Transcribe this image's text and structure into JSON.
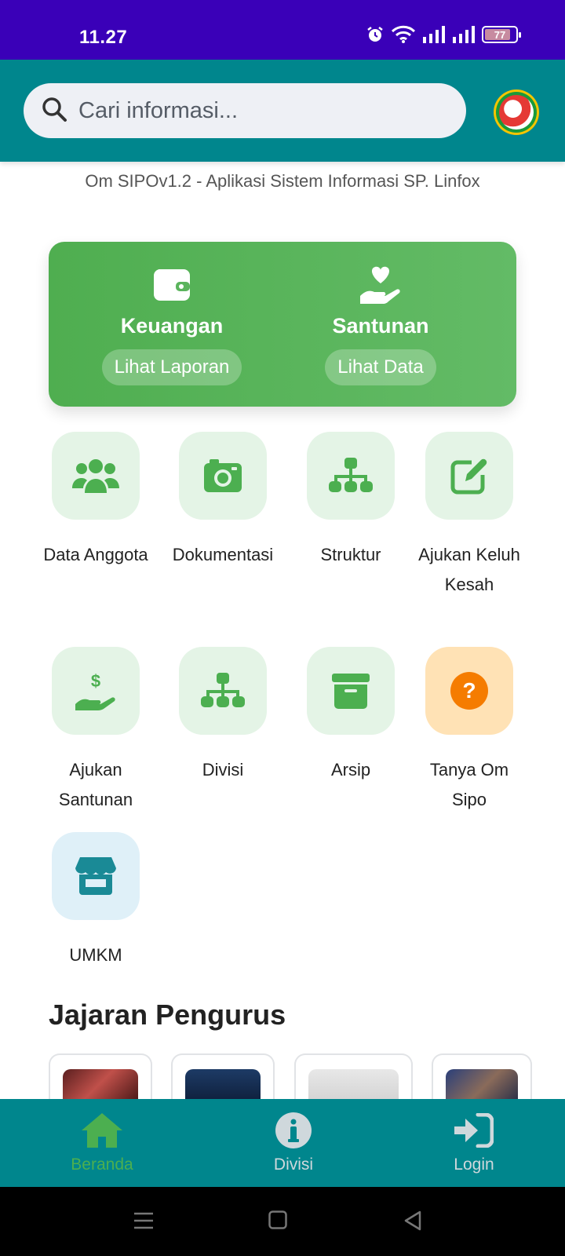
{
  "status_bar": {
    "time": "11.27",
    "battery": "77"
  },
  "search": {
    "placeholder": "Cari informasi..."
  },
  "subtitle": "Om SIPOv1.2 - Aplikasi Sistem Informasi SP. Linfox",
  "feature_card": {
    "left": {
      "title": "Keuangan",
      "button": "Lihat Laporan",
      "icon": "wallet-icon"
    },
    "right": {
      "title": "Santunan",
      "button": "Lihat Data",
      "icon": "hand-heart-icon"
    }
  },
  "menu": [
    {
      "label": "Data Anggota",
      "icon": "users-icon"
    },
    {
      "label": "Dokumentasi",
      "icon": "camera-icon"
    },
    {
      "label": "Struktur",
      "icon": "sitemap-icon"
    },
    {
      "label": "Ajukan Keluh Kesah",
      "icon": "edit-icon"
    },
    {
      "label": "Ajukan Santunan",
      "icon": "hand-dollar-icon"
    },
    {
      "label": "Divisi",
      "icon": "sitemap-icon"
    },
    {
      "label": "Arsip",
      "icon": "archive-icon"
    },
    {
      "label": "Tanya Om Sipo",
      "icon": "question-icon"
    },
    {
      "label": "UMKM",
      "icon": "store-icon"
    }
  ],
  "section_title": "Jajaran Pengurus",
  "bottom_nav": [
    {
      "label": "Beranda",
      "icon": "home-icon",
      "active": true
    },
    {
      "label": "Divisi",
      "icon": "info-icon",
      "active": false
    },
    {
      "label": "Login",
      "icon": "login-icon",
      "active": false
    }
  ],
  "colors": {
    "status_bar": "#3a00b8",
    "header": "#00868d",
    "primary_green": "#4caf50",
    "tile_green": "#e4f4e6",
    "tile_orange": "#ffe2b5",
    "tile_blue": "#dff0f8",
    "accent_orange": "#f57c00",
    "accent_teal": "#1a8a96"
  }
}
